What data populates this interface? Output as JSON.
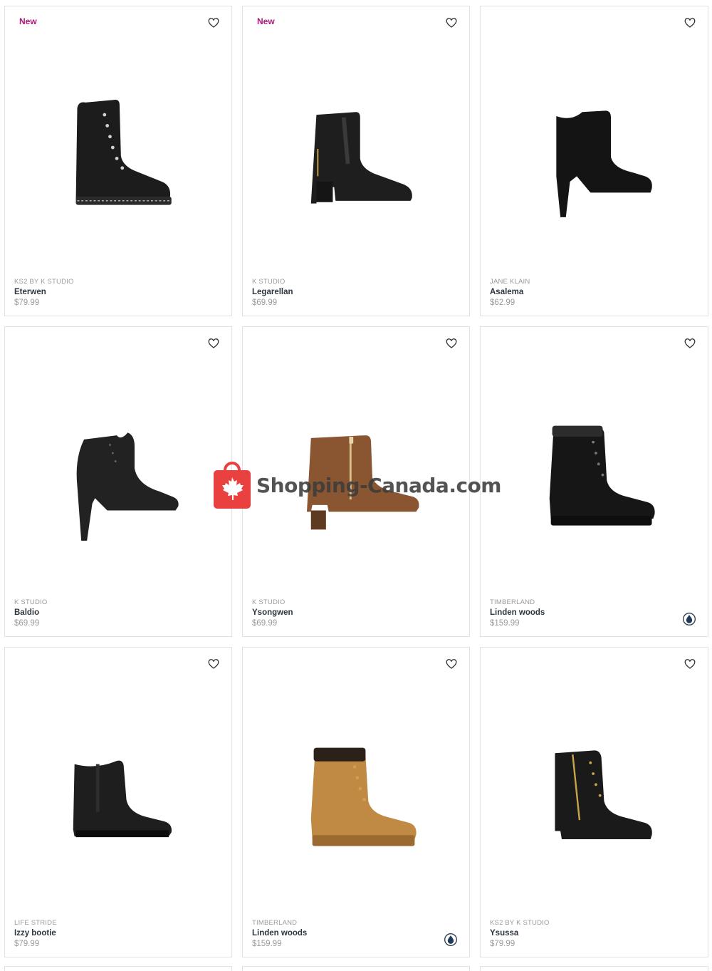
{
  "products": [
    {
      "badge": "New",
      "brand": "KS2 BY K STUDIO",
      "name": "Eterwen",
      "price": "$79.99",
      "waterproof": false,
      "image": "black-lace-up-combat-boot"
    },
    {
      "badge": "New",
      "brand": "K STUDIO",
      "name": "Legarellan",
      "price": "$69.99",
      "waterproof": false,
      "image": "black-chelsea-ankle-boot"
    },
    {
      "badge": "",
      "brand": "JANE KLAIN",
      "name": "Asalema",
      "price": "$62.99",
      "waterproof": false,
      "image": "black-suede-heeled-bootie"
    },
    {
      "badge": "",
      "brand": "K STUDIO",
      "name": "Baldio",
      "price": "$69.99",
      "waterproof": false,
      "image": "black-stiletto-bootie"
    },
    {
      "badge": "",
      "brand": "K STUDIO",
      "name": "Ysongwen",
      "price": "$69.99",
      "waterproof": false,
      "image": "cognac-zip-ankle-boot"
    },
    {
      "badge": "",
      "brand": "TIMBERLAND",
      "name": "Linden woods",
      "price": "$159.99",
      "waterproof": true,
      "image": "black-lace-up-work-boot"
    },
    {
      "badge": "",
      "brand": "LIFE STRIDE",
      "name": "Izzy bootie",
      "price": "$79.99",
      "waterproof": false,
      "image": "black-wedge-bootie"
    },
    {
      "badge": "",
      "brand": "TIMBERLAND",
      "name": "Linden woods",
      "price": "$159.99",
      "waterproof": true,
      "image": "wheat-lace-up-work-boot"
    },
    {
      "badge": "",
      "brand": "KS2 BY K STUDIO",
      "name": "Ysussa",
      "price": "$79.99",
      "waterproof": false,
      "image": "black-zip-lace-up-boot"
    }
  ],
  "watermark": {
    "text": "Shopping-Canada.com"
  },
  "colors": {
    "accent_badge": "#b0187a",
    "watermark_red": "#e8413f",
    "leather_black": "#1c1c1c",
    "cognac": "#8a5632",
    "wheat": "#c08a45"
  }
}
